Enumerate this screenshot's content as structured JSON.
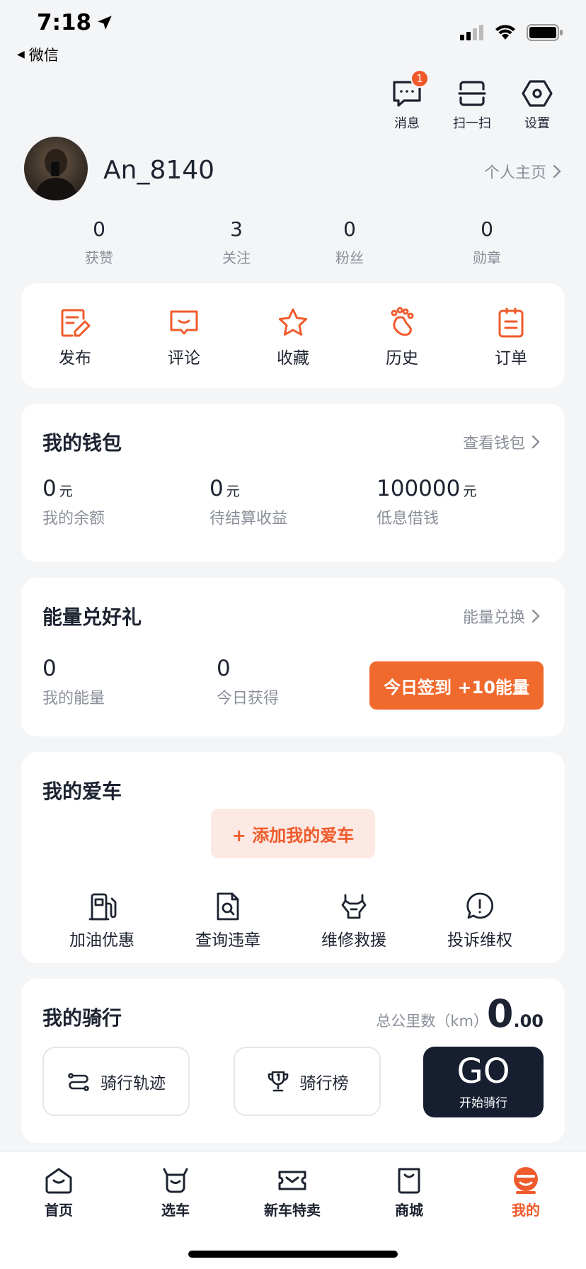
{
  "status_bar": {
    "time": "7:18",
    "back_label": "微信"
  },
  "top_actions": {
    "messages_label": "消息",
    "messages_badge": "1",
    "scan_label": "扫一扫",
    "settings_label": "设置"
  },
  "profile": {
    "username": "An_8140",
    "home_link": "个人主页",
    "stats": [
      {
        "value": "0",
        "label": "获赞"
      },
      {
        "value": "3",
        "label": "关注"
      },
      {
        "value": "0",
        "label": "粉丝"
      },
      {
        "value": "0",
        "label": "勋章"
      }
    ]
  },
  "quick_actions": [
    {
      "label": "发布",
      "icon": "edit-icon"
    },
    {
      "label": "评论",
      "icon": "comment-icon"
    },
    {
      "label": "收藏",
      "icon": "star-icon"
    },
    {
      "label": "历史",
      "icon": "footprint-icon"
    },
    {
      "label": "订单",
      "icon": "order-icon"
    }
  ],
  "wallet": {
    "title": "我的钱包",
    "link": "查看钱包",
    "items": [
      {
        "value": "0",
        "unit": "元",
        "label": "我的余额"
      },
      {
        "value": "0",
        "unit": "元",
        "label": "待结算收益"
      },
      {
        "value": "100000",
        "unit": "元",
        "label": "低息借钱"
      }
    ]
  },
  "energy": {
    "title": "能量兑好礼",
    "link": "能量兑换",
    "items": [
      {
        "value": "0",
        "label": "我的能量"
      },
      {
        "value": "0",
        "label": "今日获得"
      }
    ],
    "sign_button": "今日签到 +10能量"
  },
  "my_car": {
    "title": "我的爱车",
    "add_button": "+ 添加我的爱车",
    "services": [
      {
        "label": "加油优惠",
        "icon": "fuel-icon"
      },
      {
        "label": "查询违章",
        "icon": "violation-search-icon"
      },
      {
        "label": "维修救援",
        "icon": "repair-icon"
      },
      {
        "label": "投诉维权",
        "icon": "complaint-icon"
      }
    ]
  },
  "riding": {
    "title": "我的骑行",
    "total_km_label": "总公里数（km）",
    "total_km_int": "0",
    "total_km_dec": ".00",
    "track_button": "骑行轨迹",
    "ranking_button": "骑行榜",
    "go_label": "GO",
    "go_sub": "开始骑行"
  },
  "tabbar": [
    {
      "label": "首页",
      "icon": "home-icon"
    },
    {
      "label": "选车",
      "icon": "car-select-icon"
    },
    {
      "label": "新车特卖",
      "icon": "ticket-icon"
    },
    {
      "label": "商城",
      "icon": "shop-icon"
    },
    {
      "label": "我的",
      "icon": "profile-icon",
      "active": true
    }
  ],
  "colors": {
    "accent": "#ef5b2c",
    "text": "#1d2330",
    "muted": "#8a8f99",
    "background": "#f4f5f7",
    "dark_button": "#161e30"
  }
}
